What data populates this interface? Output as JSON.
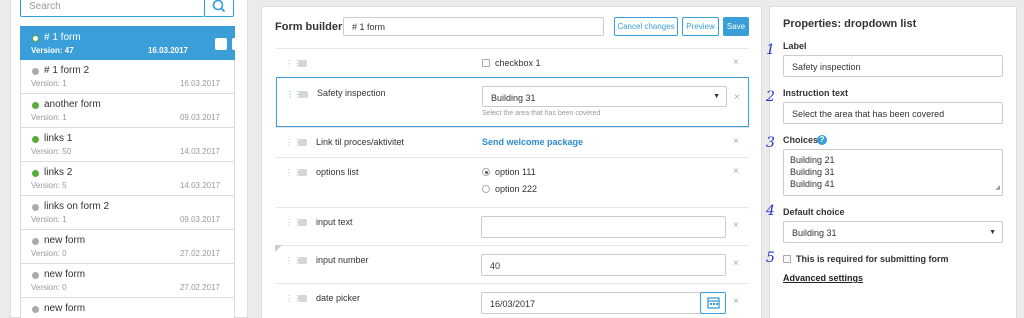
{
  "sidebar": {
    "search_placeholder": "Search",
    "forms": [
      {
        "name": "# 1 form",
        "version": "Version: 47",
        "date": "16.03.2017",
        "status_color": "#3a9fd8",
        "active": true
      },
      {
        "name": "# 1 form 2",
        "version": "Version: 1",
        "date": "16.03.2017",
        "status_color": "#aaaaaa"
      },
      {
        "name": "another form",
        "version": "Version: 1",
        "date": "09.03.2017",
        "status_color": "#5aaa3a"
      },
      {
        "name": "links 1",
        "version": "Version: 50",
        "date": "14.03.2017",
        "status_color": "#5aaa3a"
      },
      {
        "name": "links 2",
        "version": "Version: 5",
        "date": "14.03.2017",
        "status_color": "#5aaa3a"
      },
      {
        "name": "links on form 2",
        "version": "Version: 1",
        "date": "09.03.2017",
        "status_color": "#aaaaaa"
      },
      {
        "name": "new form",
        "version": "Version: 0",
        "date": "27.02.2017",
        "status_color": "#aaaaaa"
      },
      {
        "name": "new form",
        "version": "Version: 0",
        "date": "27.02.2017",
        "status_color": "#aaaaaa"
      },
      {
        "name": "new form",
        "version": "",
        "date": "",
        "status_color": "#aaaaaa"
      }
    ]
  },
  "builder": {
    "title": "Form builder",
    "form_name": "# 1 form",
    "cancel_label": "Cancel changes",
    "preview_label": "Preview",
    "save_label": "Save",
    "fields": {
      "checkbox_label": "checkbox 1",
      "dropdown_label": "Safety inspection",
      "dropdown_value": "Building 31",
      "dropdown_help": "Select the area that has been covered",
      "link_label": "Link til proces/aktivitet",
      "link_text": "Send welcome package",
      "options_label": "options list",
      "option_1": "option 111",
      "option_2": "option 222",
      "input_text_label": "input text",
      "input_text_value": "",
      "input_number_label": "input number",
      "input_number_value": "40",
      "date_label": "date picker",
      "date_value": "16/03/2017"
    },
    "remove_glyph": "×"
  },
  "properties": {
    "title": "Properties: dropdown list",
    "label_heading": "Label",
    "label_value": "Safety inspection",
    "instruction_heading": "Instruction text",
    "instruction_value": "Select the area that has been covered",
    "choices_heading": "Choices",
    "choices": [
      "Building 21",
      "Building 31",
      "Building 41"
    ],
    "default_heading": "Default choice",
    "default_value": "Building 31",
    "required_label": "This is required for submitting form",
    "advanced_link": "Advanced settings",
    "annotations": [
      "1",
      "2",
      "3",
      "4",
      "5"
    ]
  },
  "colors": {
    "accent": "#3a9fd8",
    "link": "#2e8ccf",
    "annotation": "#2233cc"
  }
}
